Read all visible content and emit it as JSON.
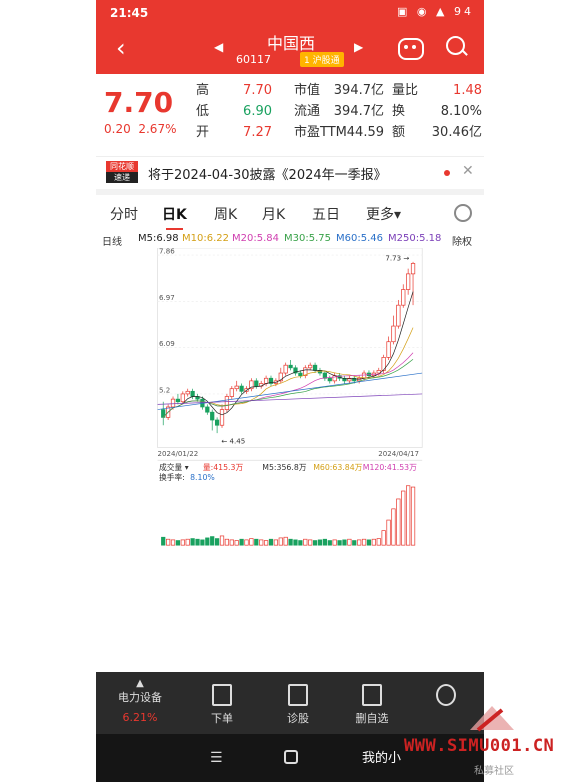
{
  "status": {
    "time": "21:45",
    "battery": "94"
  },
  "header": {
    "name": "中国西",
    "code": "60117",
    "market_badge": "1 沪股通"
  },
  "quote": {
    "price": "7.70",
    "change": "0.20",
    "change_pct": "2.67%",
    "rows": [
      {
        "l1": "高",
        "v1": "7.70",
        "l2": "市值",
        "v2": "394.7亿",
        "l3": "量比",
        "v3": "1.48"
      },
      {
        "l1": "低",
        "v1": "6.90",
        "l2": "流通",
        "v2": "394.7亿",
        "l3": "换",
        "v3": "8.10%"
      },
      {
        "l1": "开",
        "v1": "7.27",
        "l2": "市盈TTM",
        "v2": "44.59",
        "l3": "额",
        "v3": "30.46亿"
      }
    ]
  },
  "news": {
    "logo_top": "同花顺",
    "logo_bottom": "速递",
    "text": "将于2024-04-30披露《2024年一季报》"
  },
  "tabs": [
    "分时",
    "日K",
    "周K",
    "月K",
    "五日",
    "更多▾"
  ],
  "ma": {
    "kind": "日线",
    "ma5": "M5:6.98",
    "ma10": "M10:6.22",
    "ma20": "M20:5.84",
    "ma30": "M30:5.75",
    "ma60": "M60:5.46",
    "ma250": "M250:5.18",
    "adjust": "除权"
  },
  "volume": {
    "label": "成交量 ▾",
    "vol": "量:415.3万",
    "m5": "M5:356.8万",
    "m60": "M60:63.84万",
    "m120": "M120:41.53万",
    "turnover_label": "换手率:",
    "turnover": "8.10%"
  },
  "chart_data": {
    "type": "candlestick",
    "y_ticks": [
      "7.86",
      "6.97",
      "6.09",
      "5.2"
    ],
    "ylim": [
      4.2,
      7.86
    ],
    "x_start": "2024/01/22",
    "x_end": "2024/04/17",
    "high_label": "7.73",
    "low_label": "4.45",
    "candles": [
      [
        4.9,
        4.75,
        5.05,
        4.6
      ],
      [
        4.75,
        4.95,
        5.0,
        4.7
      ],
      [
        4.95,
        5.1,
        5.15,
        4.9
      ],
      [
        5.1,
        5.05,
        5.2,
        5.0
      ],
      [
        5.05,
        5.2,
        5.25,
        5.0
      ],
      [
        5.2,
        5.25,
        5.3,
        5.15
      ],
      [
        5.25,
        5.15,
        5.3,
        5.1
      ],
      [
        5.15,
        5.1,
        5.2,
        5.05
      ],
      [
        5.1,
        4.95,
        5.15,
        4.9
      ],
      [
        4.95,
        4.85,
        5.0,
        4.8
      ],
      [
        4.85,
        4.7,
        4.9,
        4.5
      ],
      [
        4.7,
        4.6,
        4.75,
        4.45
      ],
      [
        4.6,
        4.9,
        5.0,
        4.55
      ],
      [
        4.9,
        5.15,
        5.2,
        4.85
      ],
      [
        5.15,
        5.3,
        5.35,
        5.1
      ],
      [
        5.3,
        5.35,
        5.45,
        5.25
      ],
      [
        5.35,
        5.25,
        5.4,
        5.2
      ],
      [
        5.25,
        5.3,
        5.35,
        5.2
      ],
      [
        5.3,
        5.45,
        5.5,
        5.25
      ],
      [
        5.45,
        5.35,
        5.5,
        5.3
      ],
      [
        5.35,
        5.4,
        5.45,
        5.3
      ],
      [
        5.4,
        5.5,
        5.55,
        5.35
      ],
      [
        5.5,
        5.4,
        5.55,
        5.35
      ],
      [
        5.4,
        5.45,
        5.5,
        5.35
      ],
      [
        5.45,
        5.6,
        5.7,
        5.4
      ],
      [
        5.6,
        5.75,
        5.8,
        5.55
      ],
      [
        5.75,
        5.7,
        5.85,
        5.65
      ],
      [
        5.7,
        5.6,
        5.75,
        5.55
      ],
      [
        5.6,
        5.55,
        5.65,
        5.5
      ],
      [
        5.55,
        5.7,
        5.75,
        5.5
      ],
      [
        5.7,
        5.75,
        5.8,
        5.65
      ],
      [
        5.75,
        5.65,
        5.8,
        5.6
      ],
      [
        5.65,
        5.6,
        5.7,
        5.55
      ],
      [
        5.6,
        5.5,
        5.65,
        5.45
      ],
      [
        5.5,
        5.45,
        5.55,
        5.4
      ],
      [
        5.45,
        5.55,
        5.6,
        5.4
      ],
      [
        5.55,
        5.5,
        5.6,
        5.45
      ],
      [
        5.5,
        5.45,
        5.55,
        5.4
      ],
      [
        5.45,
        5.5,
        5.55,
        5.4
      ],
      [
        5.5,
        5.45,
        5.55,
        5.4
      ],
      [
        5.45,
        5.5,
        5.55,
        5.4
      ],
      [
        5.5,
        5.6,
        5.65,
        5.45
      ],
      [
        5.6,
        5.55,
        5.65,
        5.5
      ],
      [
        5.55,
        5.6,
        5.65,
        5.5
      ],
      [
        5.6,
        5.65,
        5.7,
        5.55
      ],
      [
        5.65,
        5.9,
        5.95,
        5.6
      ],
      [
        5.9,
        6.2,
        6.3,
        5.85
      ],
      [
        6.2,
        6.5,
        6.7,
        6.15
      ],
      [
        6.5,
        6.9,
        7.0,
        6.45
      ],
      [
        6.9,
        7.2,
        7.3,
        6.85
      ],
      [
        7.2,
        7.5,
        7.6,
        7.1
      ],
      [
        7.5,
        7.7,
        7.73,
        6.9
      ]
    ],
    "volumes": [
      12,
      9,
      8,
      7,
      8,
      9,
      10,
      9,
      8,
      11,
      13,
      10,
      14,
      9,
      8,
      7,
      9,
      8,
      10,
      9,
      8,
      7,
      9,
      8,
      11,
      12,
      9,
      8,
      7,
      9,
      8,
      7,
      8,
      9,
      7,
      8,
      7,
      8,
      9,
      7,
      8,
      9,
      8,
      9,
      10,
      22,
      38,
      55,
      70,
      82,
      90,
      88
    ]
  },
  "footer": {
    "sector": "电力设备",
    "sector_pct": "6.21%",
    "items": [
      "下单",
      "诊股",
      "删自选"
    ]
  },
  "nav": {
    "mine": "我的小"
  },
  "watermark": {
    "url": "WWW.SIMU001.CN",
    "cn": "私募社区"
  }
}
